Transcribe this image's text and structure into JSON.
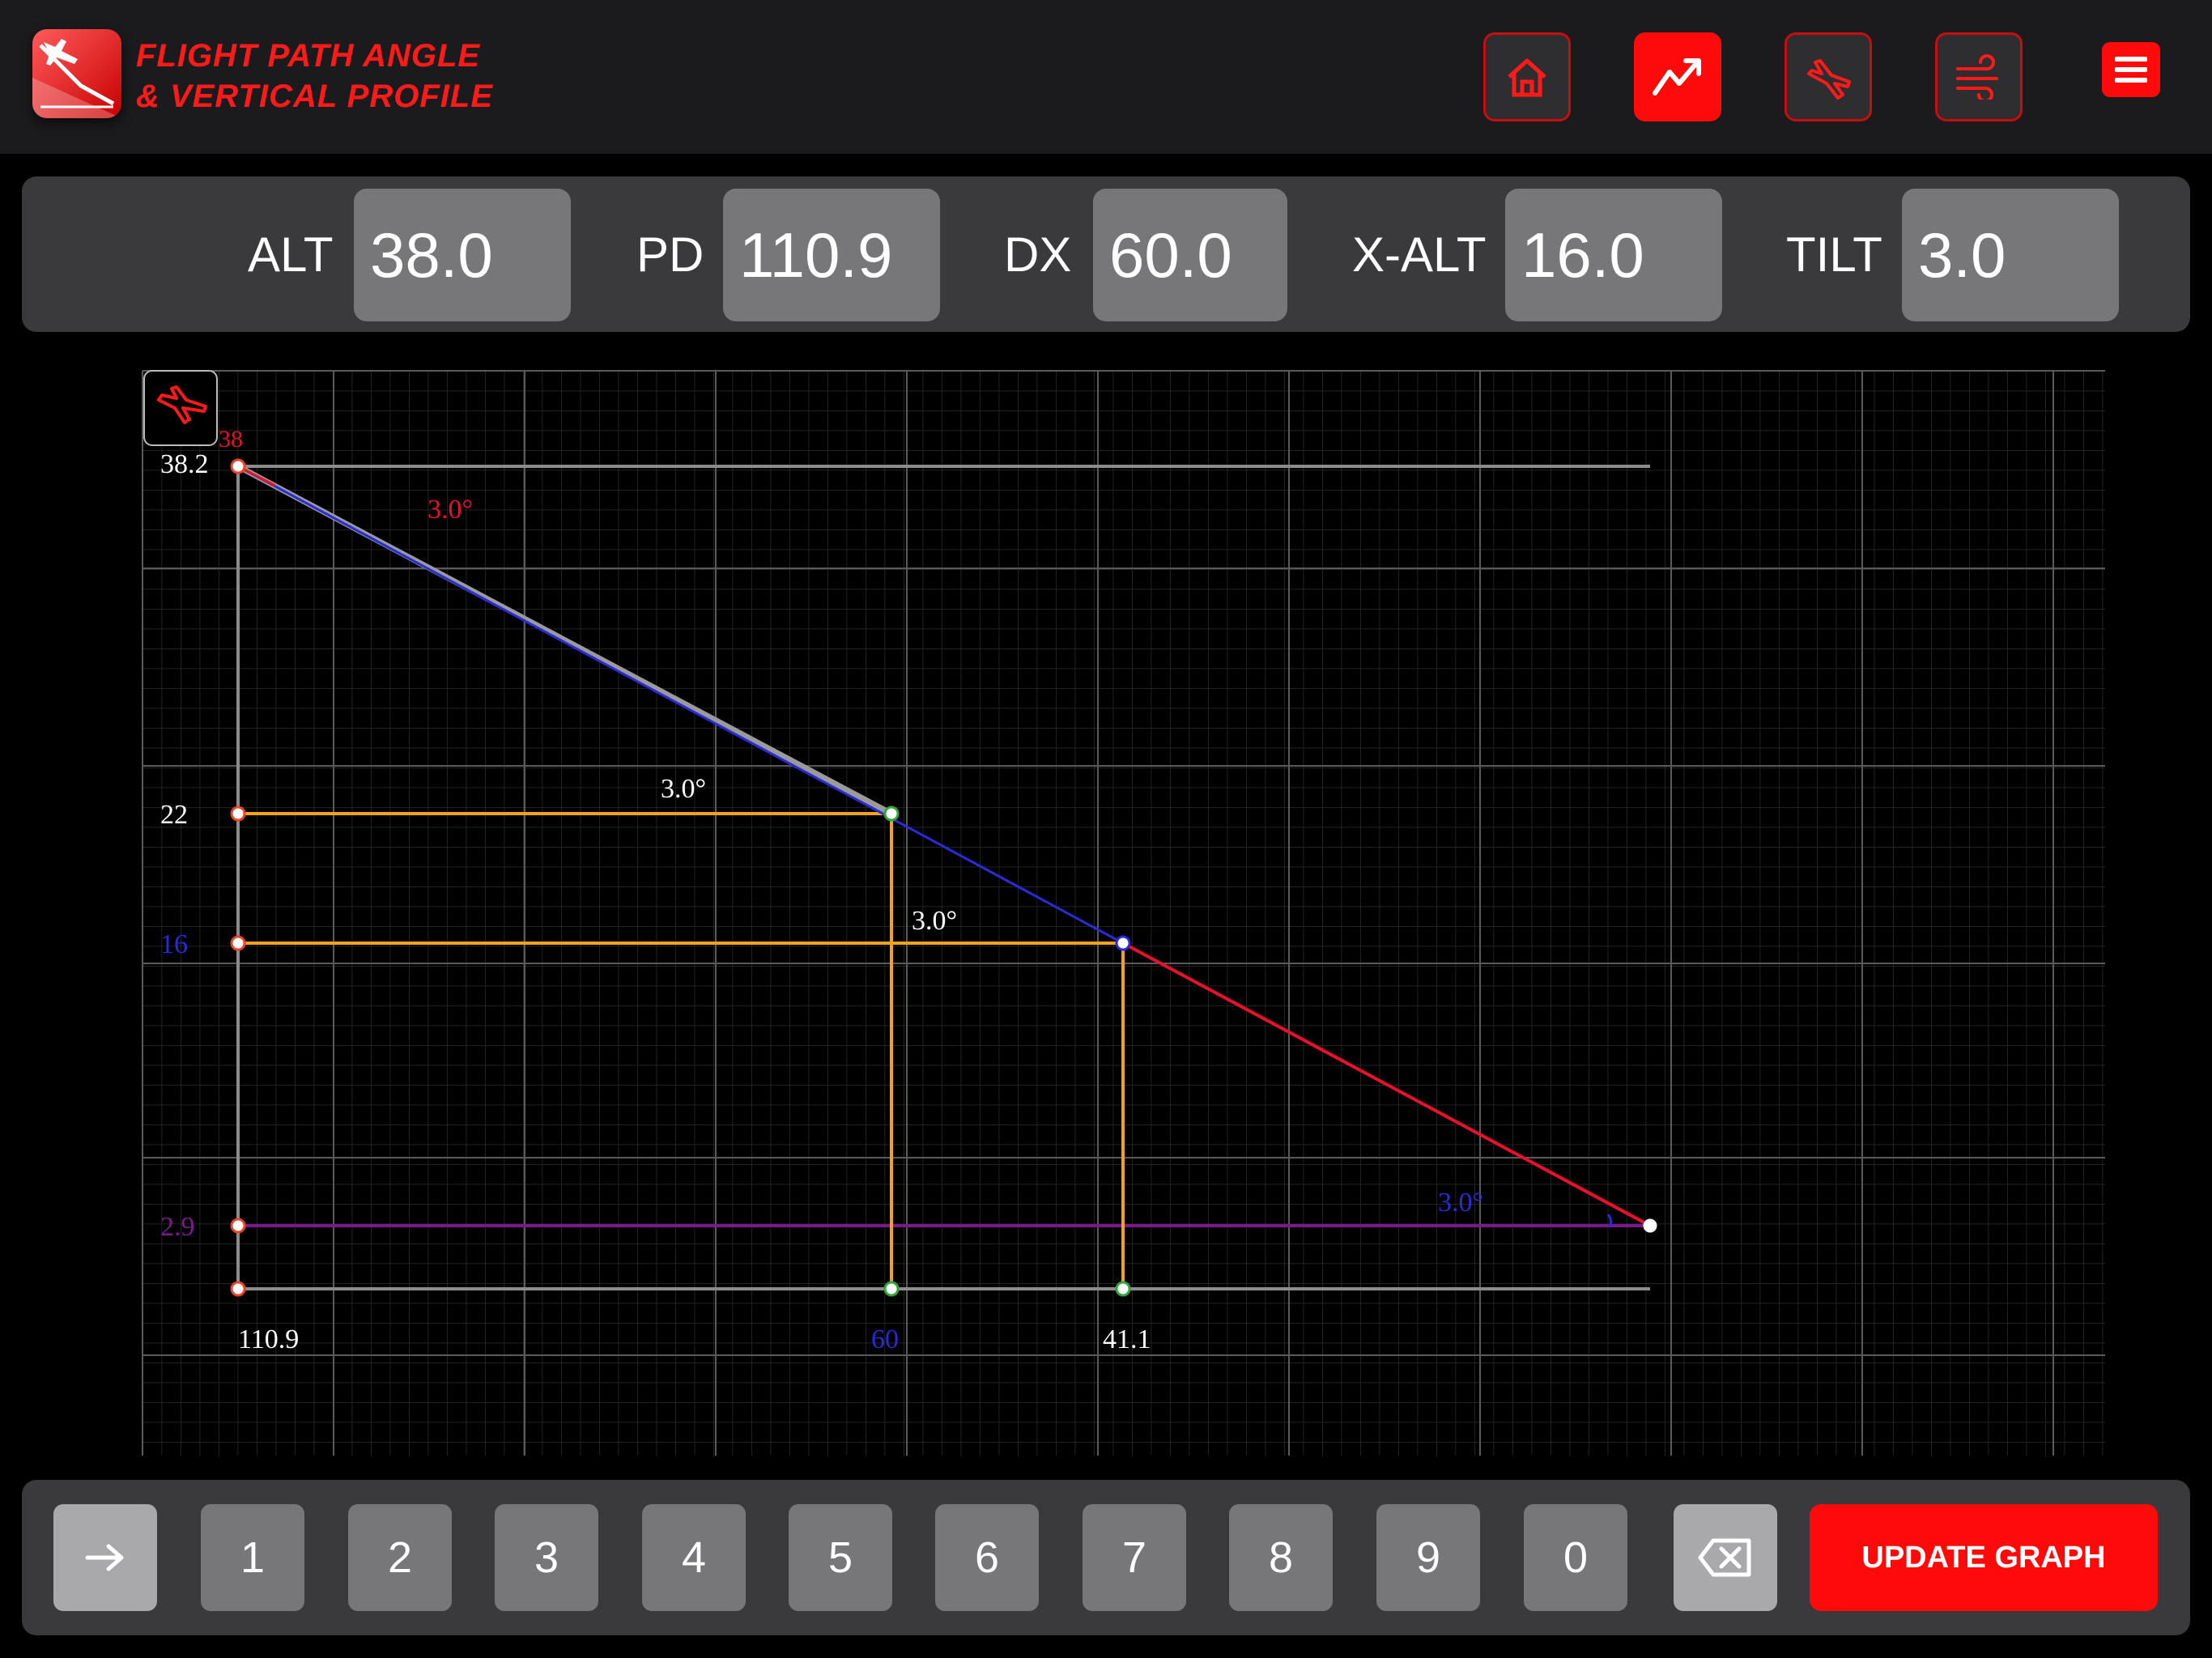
{
  "header": {
    "title_line1": "FLIGHT PATH ANGLE",
    "title_line2": "& VERTICAL PROFILE",
    "nav": [
      {
        "icon": "home-icon",
        "active": false
      },
      {
        "icon": "trend-up-icon",
        "active": true
      },
      {
        "icon": "aircraft-icon",
        "active": false
      },
      {
        "icon": "wind-icon",
        "active": false
      }
    ],
    "menu_icon": "hamburger-menu-icon"
  },
  "inputs": {
    "alt": {
      "label": "ALT",
      "value": "38.0"
    },
    "pd": {
      "label": "PD",
      "value": "110.9"
    },
    "dx": {
      "label": "DX",
      "value": "60.0"
    },
    "xalt": {
      "label": "X-ALT",
      "value": "16.0"
    },
    "tilt": {
      "label": "TILT",
      "value": "3.0"
    }
  },
  "graph": {
    "labels": {
      "top_alt": "38.2",
      "top_alt_small": "38",
      "mid_alt": "22",
      "cross_alt": "16",
      "low_alt": "2.9",
      "pd_dist": "110.9",
      "dx_dist": "60",
      "cross_dist": "41.1",
      "angle_top": "3.0°",
      "angle_mid": "3.0°",
      "angle_cross": "3.0°",
      "angle_end": "3.0°"
    },
    "colors": {
      "orange": "#f2a21b",
      "red": "#e8102a",
      "blue": "#2a2ad8",
      "gray": "#9a9a9a",
      "purple": "#7a1a8a",
      "green": "#2fa83a"
    },
    "icon": "aircraft-icon"
  },
  "keypad": {
    "keys": [
      "1",
      "2",
      "3",
      "4",
      "5",
      "6",
      "7",
      "8",
      "9",
      "0"
    ],
    "tab_icon": "arrow-right-icon",
    "backspace_icon": "backspace-icon",
    "update_label": "UPDATE GRAPH"
  }
}
